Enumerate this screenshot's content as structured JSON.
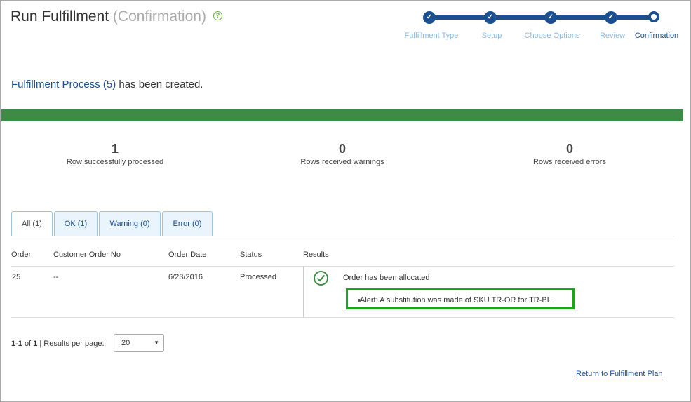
{
  "header": {
    "title": "Run Fulfillment",
    "subtitle": "(Confirmation)",
    "help_icon": "question-circle-icon"
  },
  "stepper": {
    "steps": [
      {
        "label": "Fulfillment Type",
        "state": "done"
      },
      {
        "label": "Setup",
        "state": "done"
      },
      {
        "label": "Choose Options",
        "state": "done"
      },
      {
        "label": "Review",
        "state": "done"
      },
      {
        "label": "Confirmation",
        "state": "current"
      }
    ]
  },
  "message": {
    "link": "Fulfillment Process (5)",
    "text": " has been created."
  },
  "progress": {
    "percent": 100,
    "color": "#3f8a45"
  },
  "stats": [
    {
      "value": "1",
      "label": "Row successfully processed"
    },
    {
      "value": "0",
      "label": "Rows received warnings"
    },
    {
      "value": "0",
      "label": "Rows received errors"
    }
  ],
  "tabs": [
    {
      "label": "All (1)",
      "active": true
    },
    {
      "label": "OK (1)",
      "active": false
    },
    {
      "label": "Warning (0)",
      "active": false
    },
    {
      "label": "Error (0)",
      "active": false
    }
  ],
  "table": {
    "columns": [
      "Order",
      "Customer Order No",
      "Order Date",
      "Status",
      "Results"
    ],
    "rows": [
      {
        "order": "25",
        "customer_order_no": "--",
        "order_date": "6/23/2016",
        "status": "Processed",
        "result_icon": "check-circle-icon",
        "result_text": "Order has been allocated",
        "alert": "Alert: A substitution was made of SKU TR-OR for TR-BL"
      }
    ]
  },
  "pagination": {
    "range": "1-1",
    "of": " of ",
    "total": "1",
    "per_page_label": "| Results per page:",
    "per_page_value": "20"
  },
  "footer": {
    "return_link": "Return to Fulfillment Plan"
  },
  "colors": {
    "accent": "#1b4f8f",
    "success": "#3f8a45",
    "highlight": "#1aa61a"
  }
}
